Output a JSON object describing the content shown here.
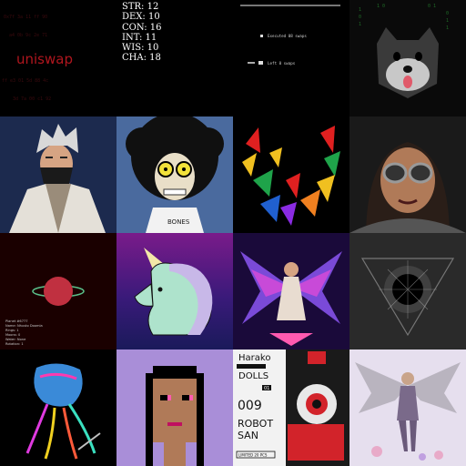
{
  "gallery": {
    "tiles": [
      {
        "name": "uniswap-wordmark-tile",
        "text": "uniswap"
      },
      {
        "name": "loot-stats-tile",
        "stats": [
          "STR: 12",
          "DEX: 10",
          "CON: 16",
          "INT: 11",
          "WIS: 10",
          "CHA: 18"
        ]
      },
      {
        "name": "terminal-text-tile",
        "line1": "Executed 08 swaps",
        "line2": "Left 0 swaps"
      },
      {
        "name": "matrix-dog-tile"
      },
      {
        "name": "masked-anime-character-tile"
      },
      {
        "name": "afro-skeleton-tile",
        "shirt_text": "BONES"
      },
      {
        "name": "geometric-triangles-tile"
      },
      {
        "name": "goggles-portrait-tile"
      },
      {
        "name": "planet-ring-tile"
      },
      {
        "name": "unicorn-tile"
      },
      {
        "name": "winged-figure-tile"
      },
      {
        "name": "dark-orb-triangle-tile"
      },
      {
        "name": "neon-creature-tile"
      },
      {
        "name": "pixel-punk-tile"
      },
      {
        "name": "harako-dolls-poster-tile",
        "brand": "Harako",
        "line1": "DOLLS",
        "number": "009",
        "title1": "ROBOT",
        "title2": "SAN",
        "series": "01",
        "limited": "LIMITED 20 PCS"
      },
      {
        "name": "angel-warrior-tile"
      }
    ]
  },
  "colors": {
    "uniswap_red": "#b0161e",
    "unicorn_bg_top": "#7a1b8a",
    "punk_bg": "#a98ed8",
    "harako_red": "#d2232a"
  }
}
